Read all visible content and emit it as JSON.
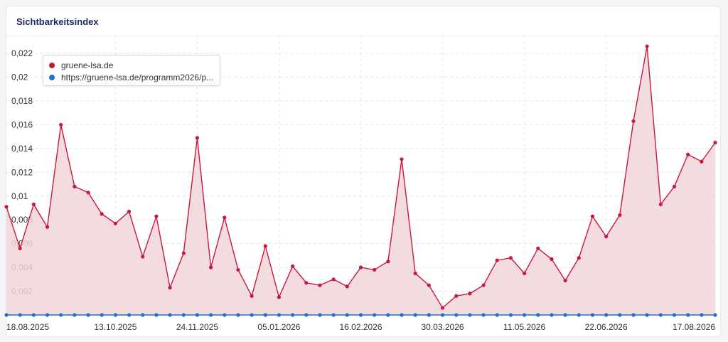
{
  "card": {
    "title": "Sichtbarkeitsindex"
  },
  "legend": {
    "items": [
      {
        "label": "gruene-lsa.de",
        "color": "#c8193c"
      },
      {
        "label": "https://gruene-lsa.de/programm2026/p...",
        "color": "#1f6fd1"
      }
    ]
  },
  "chart_data": {
    "type": "area",
    "ylim": [
      0,
      0.0235
    ],
    "yticks": [
      0.002,
      0.004,
      0.006,
      0.008,
      0.01,
      0.012,
      0.014,
      0.016,
      0.018,
      0.02,
      0.022
    ],
    "ytick_labels": [
      "0,002",
      "0,004",
      "0,006",
      "0,008",
      "0,01",
      "0,012",
      "0,014",
      "0,016",
      "0,018",
      "0,02",
      "0,022"
    ],
    "xtick_labels": [
      "18.08.2025",
      "13.10.2025",
      "24.11.2025",
      "05.01.2026",
      "16.02.2026",
      "30.03.2026",
      "11.05.2026",
      "22.06.2026",
      "17.08.2026"
    ],
    "xtick_index": [
      0,
      8,
      14,
      20,
      26,
      32,
      38,
      44,
      52
    ],
    "grid": true,
    "legend_position": "top-left",
    "series": [
      {
        "name": "gruene-lsa.de",
        "color": "#c8193c",
        "fill": "#f1d6da",
        "values": [
          0.0091,
          0.0056,
          0.0093,
          0.0074,
          0.016,
          0.0108,
          0.0103,
          0.0085,
          0.0077,
          0.0087,
          0.0049,
          0.0083,
          0.0023,
          0.0052,
          0.0149,
          0.004,
          0.0082,
          0.0038,
          0.0016,
          0.0058,
          0.0015,
          0.0041,
          0.0027,
          0.0025,
          0.003,
          0.0024,
          0.004,
          0.0038,
          0.0045,
          0.0131,
          0.0035,
          0.0025,
          0.0006,
          0.0016,
          0.0018,
          0.0025,
          0.0046,
          0.0048,
          0.0035,
          0.0056,
          0.0047,
          0.0029,
          0.0048,
          0.0083,
          0.0066,
          0.0084,
          0.0163,
          0.0226,
          0.0093,
          0.0108,
          0.0135,
          0.0129,
          0.0145
        ]
      },
      {
        "name": "https://gruene-lsa.de/programm2026/p...",
        "color": "#1f6fd1",
        "values": [
          0,
          0,
          0,
          0,
          0,
          0,
          0,
          0,
          0,
          0,
          0,
          0,
          0,
          0,
          0,
          0,
          0,
          0,
          0,
          0,
          0,
          0,
          0,
          0,
          0,
          0,
          0,
          0,
          0,
          0,
          0,
          0,
          0,
          0,
          0,
          0,
          0,
          0,
          0,
          0,
          0,
          0,
          0,
          0,
          0,
          0,
          0,
          0,
          0,
          0,
          0,
          0,
          0
        ]
      }
    ]
  }
}
